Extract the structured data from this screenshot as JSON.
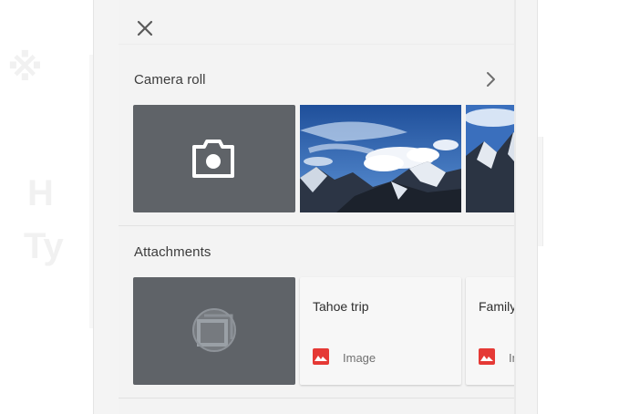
{
  "sheet": {
    "close_icon": "close-icon",
    "camera_roll": {
      "title": "Camera roll",
      "more_icon": "chevron-right-icon",
      "camera_tile_icon": "camera-icon",
      "photos": [
        {
          "description": "mountain-sky-photo"
        },
        {
          "description": "mountain-sky-photo"
        }
      ]
    },
    "attachments": {
      "title": "Attachments",
      "drive_tile_icon": "drive-icon",
      "items": [
        {
          "name": "Tahoe trip",
          "type": "Image"
        },
        {
          "name": "Family",
          "type": "Image"
        }
      ]
    }
  },
  "colors": {
    "tile_gray": "#5f6368",
    "image_type_red": "#e53935",
    "sheet_background": "#f3f3f3"
  }
}
